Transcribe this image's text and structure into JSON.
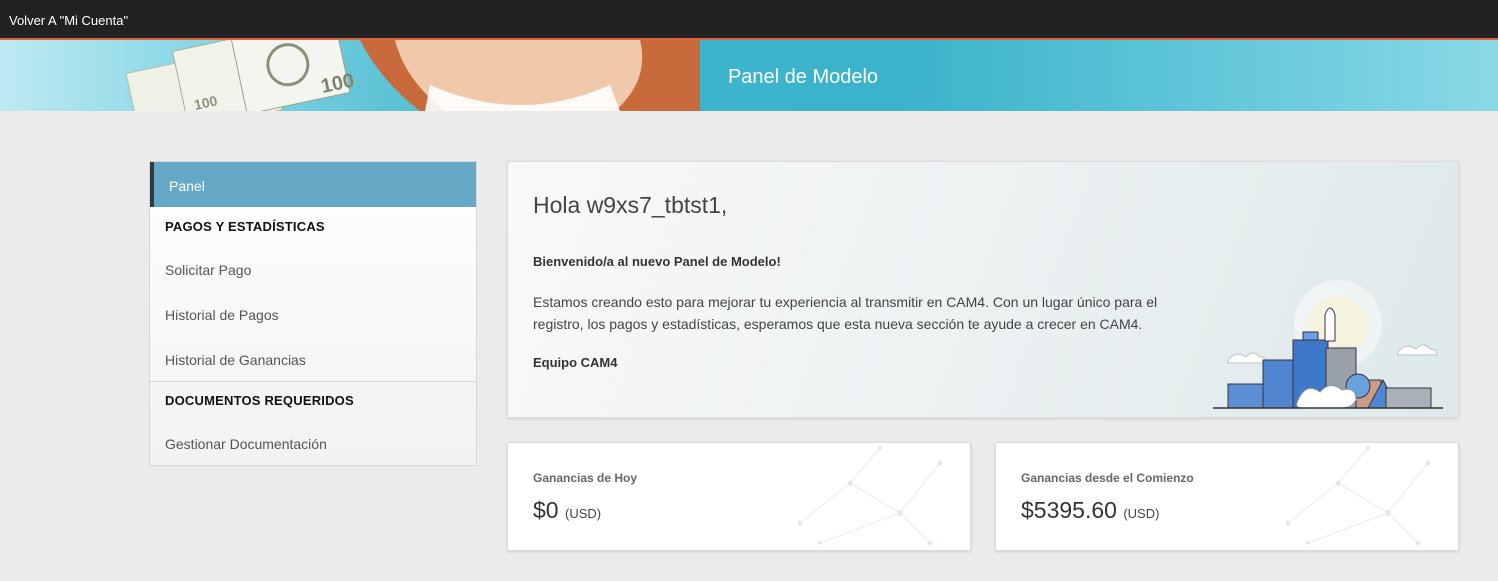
{
  "topbar": {
    "back_link": "Volver A \"Mi Cuenta\""
  },
  "hero": {
    "title": "Panel de Modelo"
  },
  "sidebar": {
    "active_item": "Panel",
    "sections": [
      {
        "heading": "PAGOS Y ESTADÍSTICAS",
        "items": [
          "Solicitar Pago",
          "Historial de Pagos",
          "Historial de Ganancias"
        ]
      },
      {
        "heading": "DOCUMENTOS REQUERIDOS",
        "items": [
          "Gestionar Documentación"
        ]
      }
    ]
  },
  "welcome": {
    "greeting": "Hola w9xs7_tbtst1,",
    "headline": "Bienvenido/a al nuevo Panel de Modelo!",
    "body": "Estamos creando esto para mejorar tu experiencia al transmitir en CAM4. Con un lugar único para el registro, los pagos y estadísticas, esperamos que esta nueva sección te ayude a crecer en CAM4.",
    "signature": "Equipo CAM4"
  },
  "cards": [
    {
      "label": "Ganancias de Hoy",
      "amount": "$0",
      "currency": "(USD)"
    },
    {
      "label": "Ganancias desde el Comienzo",
      "amount": "$5395.60",
      "currency": "(USD)"
    }
  ],
  "colors": {
    "accent": "#65a9c6",
    "topbar": "#222222",
    "topbar_border": "#e0643b"
  }
}
